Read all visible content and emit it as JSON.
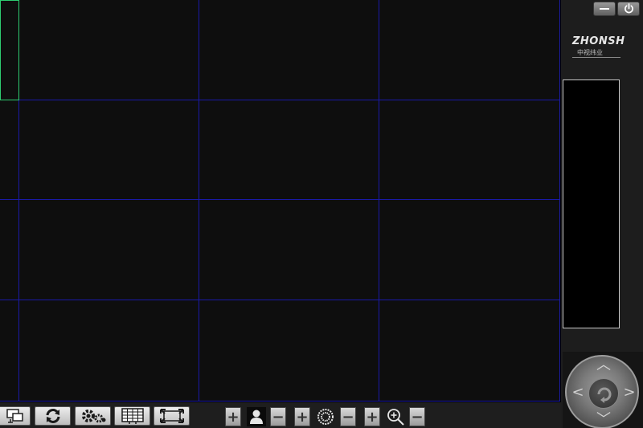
{
  "brand": {
    "name": "ZHONSH",
    "subtitle": "中视纬业"
  },
  "window_controls": {
    "minimize": "minimize-icon",
    "power": "power-icon"
  },
  "grid": {
    "rows": 4,
    "columns": 4,
    "selected_cell": "row-1-col-1",
    "line_color": "#1a1aa8",
    "selected_color": "#2ecc71"
  },
  "toolbar": {
    "buttons": [
      "devices-icon",
      "refresh-icon",
      "settings-icon",
      "grid-layout-icon",
      "fullscreen-icon"
    ]
  },
  "ptz_controls": {
    "groups": [
      {
        "plus": "+",
        "icon": "person-icon",
        "minus": "−"
      },
      {
        "plus": "+",
        "icon": "iris-icon",
        "minus": "−"
      },
      {
        "plus": "+",
        "icon": "zoom-icon",
        "minus": "−"
      }
    ]
  },
  "ptz_pad": {
    "arrows": [
      "up",
      "down",
      "left",
      "right"
    ],
    "center": "auto-rotate-icon"
  }
}
